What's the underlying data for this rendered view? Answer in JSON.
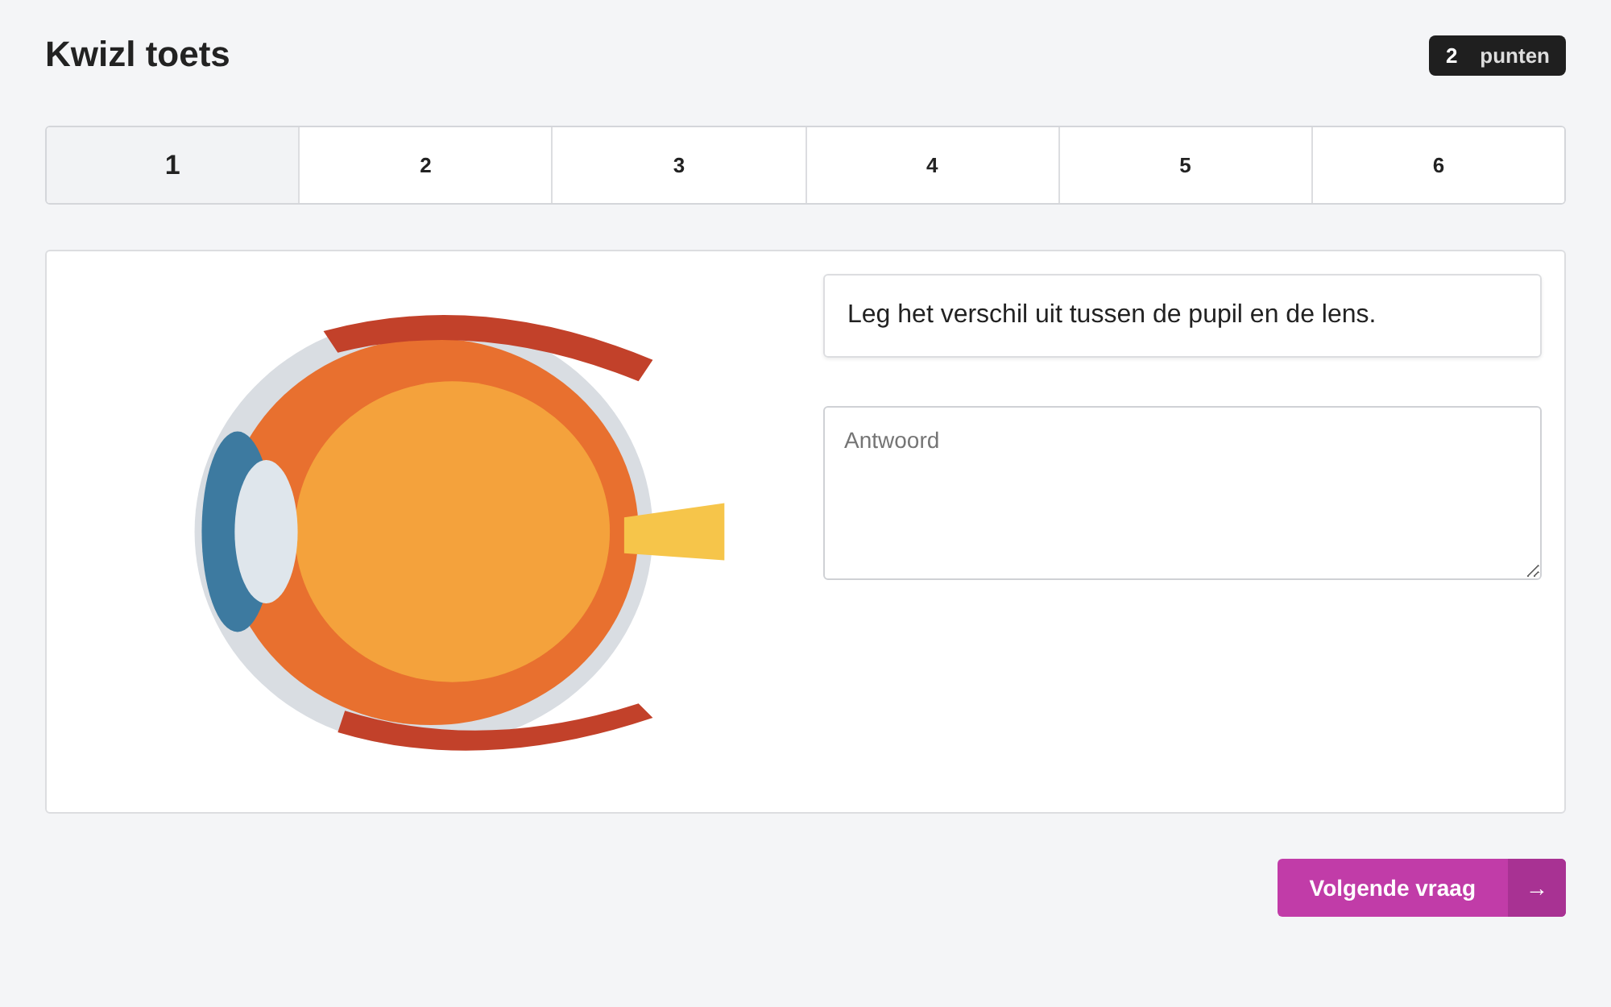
{
  "title": "Kwizl toets",
  "score": {
    "value": "2",
    "unit": "punten"
  },
  "steps": [
    {
      "label": "1",
      "selected": true
    },
    {
      "label": "2",
      "selected": false
    },
    {
      "label": "3",
      "selected": false
    },
    {
      "label": "4",
      "selected": false
    },
    {
      "label": "5",
      "selected": false
    },
    {
      "label": "6",
      "selected": false
    }
  ],
  "question": "Leg het verschil uit tussen de pupil en de lens.",
  "answer": {
    "placeholder": "Antwoord"
  },
  "next_button": {
    "label": "Volgende vraag",
    "icon": "→"
  }
}
